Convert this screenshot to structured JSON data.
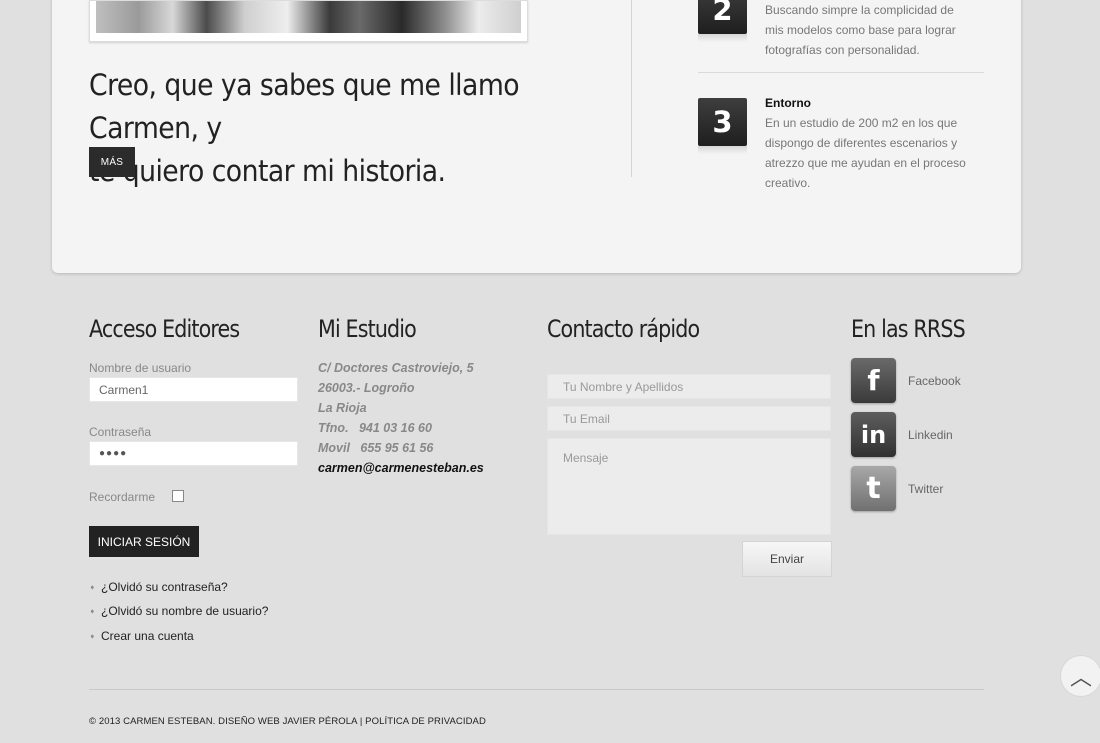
{
  "hero": {
    "headline_line1": "Creo, que ya sabes que me llamo Carmen, y",
    "headline_line2": "te quiero contar mi historia.",
    "more_label": "MÁS"
  },
  "features": [
    {
      "number": "2",
      "title": "",
      "lines": [
        "Buscando simpre la complicidad de",
        "mis modelos como base para lograr",
        "fotografías con personalidad."
      ]
    },
    {
      "number": "3",
      "title": "Entorno",
      "lines": [
        "En un estudio de 200 m2 en los que",
        "dispongo de diferentes escenarios y",
        "atrezzo que me ayudan en el proceso",
        "creativo."
      ]
    }
  ],
  "login": {
    "title": "Acceso Editores",
    "username_label": "Nombre de usuario",
    "username_value": "Carmen1",
    "password_label": "Contraseña",
    "password_value": "●●●●",
    "remember_label": "Recordarme",
    "submit_label": "INICIAR SESIÓN",
    "links": [
      "¿Olvidó su contraseña?",
      "¿Olvidó su nombre de usuario?",
      "Crear una cuenta"
    ]
  },
  "studio": {
    "title": "Mi Estudio",
    "address": [
      "C/ Doctores Castroviejo, 5",
      "26003.- Logroño",
      "La Rioja",
      "Tfno.   941 03 16 60",
      "Movil   655 95 61 56"
    ],
    "email": "carmen@carmenesteban.es"
  },
  "contact": {
    "title": "Contacto rápido",
    "name_placeholder": "Tu Nombre y Apellidos",
    "email_placeholder": "Tu Email",
    "message_placeholder": "Mensaje",
    "send_label": "Enviar"
  },
  "social": {
    "title": "En las RRSS",
    "items": [
      {
        "label": "Facebook",
        "icon": "facebook-icon",
        "glyph": "f",
        "color": "#4e4e4e"
      },
      {
        "label": "Linkedin",
        "icon": "linkedin-icon",
        "glyph": "in",
        "color": "#454545"
      },
      {
        "label": "Twitter",
        "icon": "twitter-icon",
        "glyph": "t",
        "color": "#8a8a8a"
      }
    ]
  },
  "footer": {
    "copyright": "© 2013 CARMEN ESTEBAN. DISEÑO WEB JAVIER PÉROLA | POLÍTICA DE PRIVACIDAD",
    "scroll_top_glyph": "︿"
  }
}
